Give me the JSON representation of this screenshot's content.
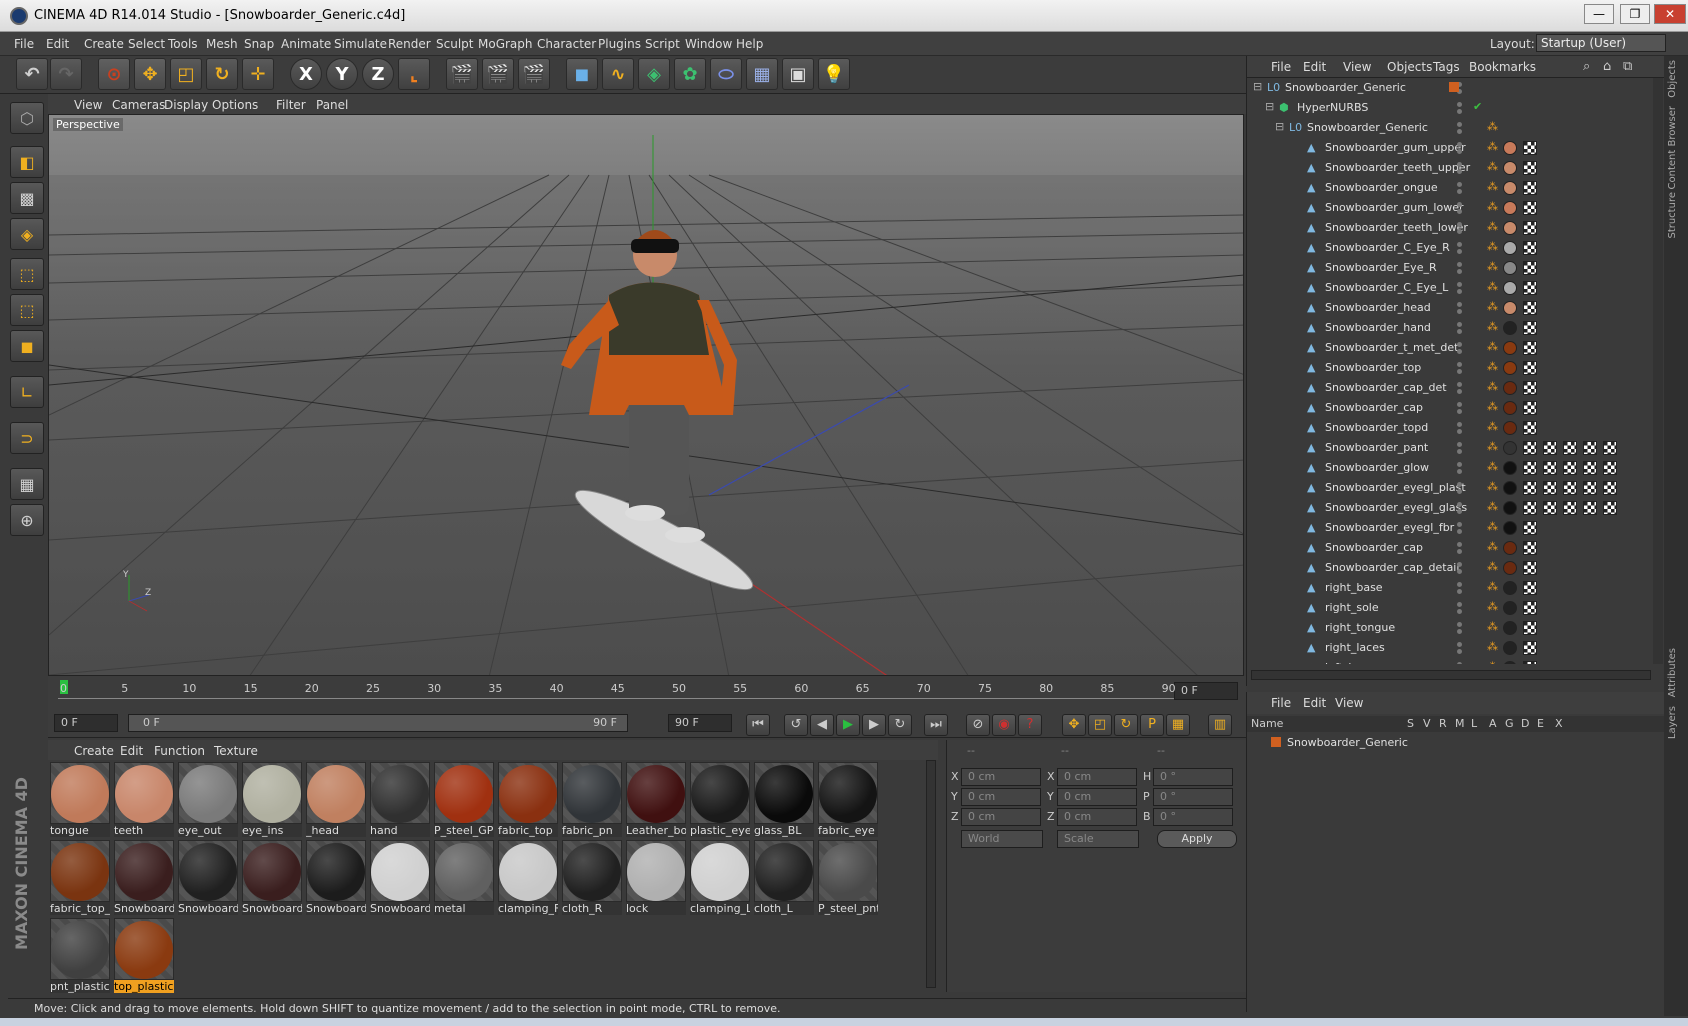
{
  "window": {
    "title": "CINEMA 4D R14.014 Studio - [Snowboarder_Generic.c4d]",
    "min": "—",
    "max": "❐",
    "close": "✕"
  },
  "menu": [
    "File",
    "Edit",
    "Create",
    "Select",
    "Tools",
    "Mesh",
    "Snap",
    "Animate",
    "Simulate",
    "Render",
    "Sculpt",
    "MoGraph",
    "Character",
    "Plugins",
    "Script",
    "Window",
    "Help"
  ],
  "layout": {
    "label": "Layout:",
    "value": "Startup (User)"
  },
  "toolbar": {
    "x_axis": "X",
    "y_axis": "Y",
    "z_axis": "Z"
  },
  "viewport": {
    "menu": [
      "View",
      "Cameras",
      "Display",
      "Options",
      "Filter",
      "Panel"
    ],
    "label": "Perspective",
    "axis_y": "Y",
    "axis_z": "Z"
  },
  "timeline": {
    "ticks": [
      "0",
      "5",
      "10",
      "15",
      "20",
      "25",
      "30",
      "35",
      "40",
      "45",
      "50",
      "55",
      "60",
      "65",
      "70",
      "75",
      "80",
      "85",
      "90"
    ],
    "current_frame": "0 F",
    "start": "0 F",
    "range_start": "0 F",
    "range_end": "90 F",
    "end": "90 F"
  },
  "material_menu": [
    "Create",
    "Edit",
    "Function",
    "Texture"
  ],
  "materials": [
    {
      "name": "tongue",
      "color": "#c07a5a"
    },
    {
      "name": "teeth",
      "color": "#c8866a"
    },
    {
      "name": "eye_out",
      "color": "#7a7a7a"
    },
    {
      "name": "eye_ins",
      "color": "#b0b0a0"
    },
    {
      "name": "_head",
      "color": "#c08060"
    },
    {
      "name": "hand",
      "color": "#303030"
    },
    {
      "name": "P_steel_GP",
      "color": "#a03010"
    },
    {
      "name": "fabric_top",
      "color": "#8a3010"
    },
    {
      "name": "fabric_pn",
      "color": "#303438"
    },
    {
      "name": "Leather_bo",
      "color": "#401010"
    },
    {
      "name": "plastic_eye",
      "color": "#1a1a1a"
    },
    {
      "name": "glass_BL",
      "color": "#0a0a0a"
    },
    {
      "name": "fabric_eye",
      "color": "#141414"
    },
    {
      "name": "fabric_top_",
      "color": "#7a3410"
    },
    {
      "name": "Snowboard",
      "color": "#3a1e1e"
    },
    {
      "name": "Snowboard",
      "color": "#202020"
    },
    {
      "name": "Snowboard",
      "color": "#3a1e1e"
    },
    {
      "name": "Snowboard",
      "color": "#1c1c1c"
    },
    {
      "name": "Snowboard",
      "color": "#d0d0d0"
    },
    {
      "name": "metal",
      "color": "#606060"
    },
    {
      "name": "clamping_F",
      "color": "#c8c8c8"
    },
    {
      "name": "cloth_R",
      "color": "#202020"
    },
    {
      "name": "lock",
      "color": "#b0b0b0"
    },
    {
      "name": "clamping_L",
      "color": "#d0d0d0"
    },
    {
      "name": "cloth_L",
      "color": "#202020"
    },
    {
      "name": "P_steel_pnt",
      "color": "#4a4a4a"
    },
    {
      "name": "pnt_plastic",
      "color": "#404040"
    },
    {
      "name": "top_plastic",
      "color": "#8a3a10",
      "selected": true
    }
  ],
  "coords": {
    "headers": [
      "--",
      "--",
      "--"
    ],
    "x": "0 cm",
    "y": "0 cm",
    "z": "0 cm",
    "sx": "0 cm",
    "sy": "0 cm",
    "sz": "0 cm",
    "h": "0 °",
    "p": "0 °",
    "b": "0 °",
    "labels": {
      "x": "X",
      "y": "Y",
      "z": "Z",
      "h": "H",
      "p": "P",
      "b": "B"
    },
    "world": "World",
    "scale": "Scale",
    "apply": "Apply"
  },
  "status": "Move: Click and drag to move elements. Hold down SHIFT to quantize movement / add to the selection in point mode, CTRL to remove.",
  "objects_menu": [
    "File",
    "Edit",
    "View",
    "Objects",
    "Tags",
    "Bookmarks"
  ],
  "objects": [
    {
      "name": "Snowboarder_Generic",
      "level": 0
    },
    {
      "name": "HyperNURBS",
      "level": 1
    },
    {
      "name": "Snowboarder_Generic",
      "level": 2
    },
    {
      "name": "Snowboarder_gum_upper",
      "level": 3
    },
    {
      "name": "Snowboarder_teeth_upper",
      "level": 3
    },
    {
      "name": "Snowboarder_ongue",
      "level": 3
    },
    {
      "name": "Snowboarder_gum_lower",
      "level": 3
    },
    {
      "name": "Snowboarder_teeth_lower",
      "level": 3
    },
    {
      "name": "Snowboarder_C_Eye_R",
      "level": 3
    },
    {
      "name": "Snowboarder_Eye_R",
      "level": 3
    },
    {
      "name": "Snowboarder_C_Eye_L",
      "level": 3
    },
    {
      "name": "Snowboarder_head",
      "level": 3
    },
    {
      "name": "Snowboarder_hand",
      "level": 3
    },
    {
      "name": "Snowboarder_t_met_det",
      "level": 3
    },
    {
      "name": "Snowboarder_top",
      "level": 3
    },
    {
      "name": "Snowboarder_cap_det",
      "level": 3
    },
    {
      "name": "Snowboarder_cap",
      "level": 3
    },
    {
      "name": "Snowboarder_topd",
      "level": 3
    },
    {
      "name": "Snowboarder_pant",
      "level": 3
    },
    {
      "name": "Snowboarder_glow",
      "level": 3
    },
    {
      "name": "Snowboarder_eyegl_plast",
      "level": 3
    },
    {
      "name": "Snowboarder_eyegl_glass",
      "level": 3
    },
    {
      "name": "Snowboarder_eyegl_fbr",
      "level": 3
    },
    {
      "name": "Snowboarder_cap",
      "level": 3
    },
    {
      "name": "Snowboarder_cap_detail",
      "level": 3
    },
    {
      "name": "right_base",
      "level": 3
    },
    {
      "name": "right_sole",
      "level": 3
    },
    {
      "name": "right_tongue",
      "level": 3
    },
    {
      "name": "right_laces",
      "level": 3
    },
    {
      "name": "left_base",
      "level": 3
    }
  ],
  "layers_menu": [
    "File",
    "Edit",
    "View"
  ],
  "layers_cols": [
    "Name",
    "S",
    "V",
    "R",
    "M",
    "L",
    "A",
    "G",
    "D",
    "E",
    "X"
  ],
  "layer_row": "Snowboarder_Generic",
  "sidetabs": [
    "Objects",
    "Content Browser",
    "Structure",
    "Attributes",
    "Layers"
  ],
  "maxon": "MAXON CINEMA 4D"
}
